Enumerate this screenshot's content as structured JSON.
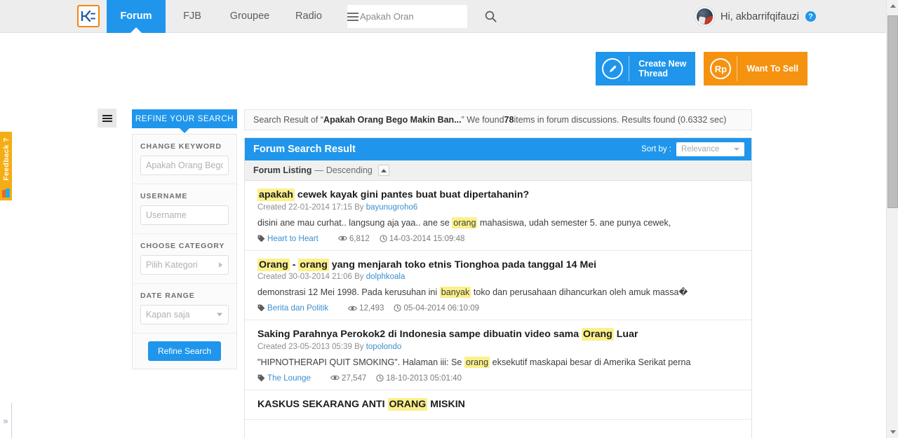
{
  "header": {
    "brand_name": "kaskus-logo",
    "nav": [
      {
        "label": "Forum",
        "active": true
      },
      {
        "label": "FJB",
        "active": false
      },
      {
        "label": "Groupee",
        "active": false
      },
      {
        "label": "Radio",
        "active": false
      }
    ],
    "search": {
      "value": "Apakah Oran",
      "placeholder": "Search",
      "menu_icon": "hamburger-icon",
      "submit_icon": "search-icon"
    },
    "user": {
      "greeting": "Hi, akbarrifqifauzi",
      "help_badge": "?"
    }
  },
  "actions": {
    "create_thread": {
      "label": "Create New\nThread",
      "label_line1": "Create New",
      "label_line2": "Thread",
      "icon": "pencil-icon",
      "color": "#1f96ec"
    },
    "want_to_sell": {
      "label": "Want To Sell",
      "icon": "rupiah-icon",
      "icon_text": "Rp",
      "color": "#f5920f"
    }
  },
  "sidebar": {
    "panel_toggle_icon": "hamburger-icon",
    "header": "REFINE YOUR SEARCH",
    "groups": [
      {
        "label": "CHANGE KEYWORD",
        "type": "input",
        "placeholder": "Apakah Orang Bego Makin Banyak",
        "value": ""
      },
      {
        "label": "USERNAME",
        "type": "input",
        "placeholder": "Username",
        "value": ""
      },
      {
        "label": "CHOOSE CATEGORY",
        "type": "select-right",
        "placeholder": "Pilih Kategori",
        "value": "Pilih Kategori"
      },
      {
        "label": "DATE RANGE",
        "type": "select-down",
        "placeholder": "Kapan saja",
        "value": "Kapan saja"
      }
    ],
    "submit_label": "Refine Search"
  },
  "results_bar": {
    "prefix": "Search Result of “",
    "query": "Apakah Orang Bego Makin Ban...",
    "mid": "” We found ",
    "count": "78",
    "suffix": " items in forum discussions. Results found (0.6332 sec)"
  },
  "results_panel": {
    "title": "Forum Search Result",
    "sort_by_label": "Sort by :",
    "sort_by_value": "Relevance",
    "listing_label": "Forum Listing",
    "listing_dash": "—",
    "listing_order": "Descending",
    "listing_toggle_icon": "caret-up-icon"
  },
  "results": [
    {
      "title_parts": [
        {
          "text": "apakah",
          "highlight": true
        },
        {
          "text": " cewek kayak gini pantes buat buat dipertahanin?",
          "highlight": false
        }
      ],
      "created_prefix": "Created 22-01-2014 17:15 By ",
      "author": "bayunugroho6",
      "snippet_parts": [
        {
          "text": "disini ane mau curhat.. langsung aja yaa.. ane se ",
          "highlight": false
        },
        {
          "text": "orang",
          "highlight": true
        },
        {
          "text": " mahasiswa, udah semester 5. ane punya cewek,",
          "highlight": false
        }
      ],
      "category": "Heart to Heart",
      "views": "6,812",
      "date": "14-03-2014 15:09:48"
    },
    {
      "title_parts": [
        {
          "text": "Orang",
          "highlight": true
        },
        {
          "text": " - ",
          "highlight": false
        },
        {
          "text": "orang",
          "highlight": true
        },
        {
          "text": " yang menjarah toko etnis Tionghoa pada tanggal 14 Mei",
          "highlight": false
        }
      ],
      "created_prefix": "Created 30-03-2014 21:06 By ",
      "author": "dolphkoala",
      "snippet_parts": [
        {
          "text": "demonstrasi 12 Mei 1998. Pada kerusuhan ini ",
          "highlight": false
        },
        {
          "text": "banyak",
          "highlight": true
        },
        {
          "text": " toko dan perusahaan dihancurkan oleh amuk massa�",
          "highlight": false
        }
      ],
      "category": "Berita dan Politik",
      "views": "12,493",
      "date": "05-04-2014 06:10:09"
    },
    {
      "title_parts": [
        {
          "text": "Saking Parahnya Perokok2 di Indonesia sampe dibuatin video sama ",
          "highlight": false
        },
        {
          "text": "Orang",
          "highlight": true
        },
        {
          "text": " Luar",
          "highlight": false
        }
      ],
      "created_prefix": "Created 23-05-2013 05:39 By ",
      "author": "topolondo",
      "snippet_parts": [
        {
          "text": "\"HIPNOTHERAPI QUIT SMOKING\". Halaman iii: Se ",
          "highlight": false
        },
        {
          "text": "orang",
          "highlight": true
        },
        {
          "text": " eksekutif maskapai besar di Amerika Serikat perna",
          "highlight": false
        }
      ],
      "category": "The Lounge",
      "views": "27,547",
      "date": "18-10-2013 05:01:40"
    },
    {
      "title_parts": [
        {
          "text": "KASKUS SEKARANG ANTI ",
          "highlight": false
        },
        {
          "text": "ORANG",
          "highlight": true
        },
        {
          "text": " MISKIN",
          "highlight": false
        }
      ],
      "created_prefix": "",
      "author": "",
      "snippet_parts": [],
      "category": "",
      "views": "",
      "date": ""
    }
  ],
  "feedback": {
    "label": "Feedback ?",
    "icon": "feedback-icon"
  },
  "expander": {
    "label": "»"
  },
  "colors": {
    "accent_blue": "#1f96ec",
    "accent_orange": "#f5920f",
    "highlight_yellow": "#fbf08a",
    "link_blue": "#3b8fd0",
    "feedback_gold": "#f5ad14"
  }
}
